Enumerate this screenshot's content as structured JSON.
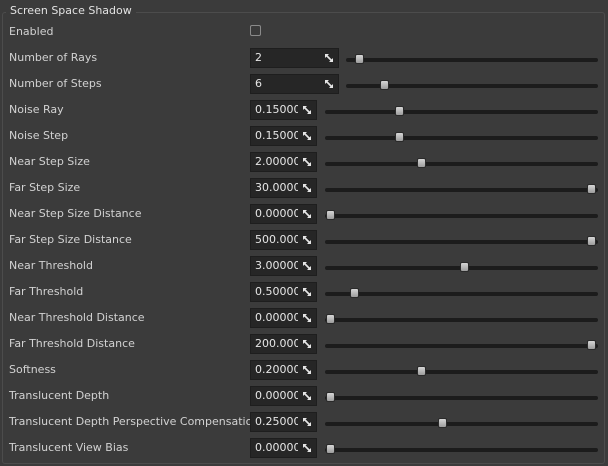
{
  "group": {
    "title": "Screen Space Shadow"
  },
  "enabled": {
    "label": "Enabled",
    "checked": false
  },
  "rows": [
    {
      "id": "number-of-rays",
      "label": "Number of Rays",
      "value": "2",
      "kind": "int",
      "slider_position": 0.05
    },
    {
      "id": "number-of-steps",
      "label": "Number of Steps",
      "value": "6",
      "kind": "int",
      "slider_position": 0.15
    },
    {
      "id": "noise-ray",
      "label": "Noise Ray",
      "value": "0.15000",
      "kind": "float",
      "slider_position": 0.27
    },
    {
      "id": "noise-step",
      "label": "Noise Step",
      "value": "0.15000",
      "kind": "float",
      "slider_position": 0.27
    },
    {
      "id": "near-step-size",
      "label": "Near Step Size",
      "value": "2.00000",
      "kind": "float",
      "slider_position": 0.35
    },
    {
      "id": "far-step-size",
      "label": "Far Step Size",
      "value": "30.00000",
      "kind": "float",
      "slider_position": 0.975
    },
    {
      "id": "near-step-size-distance",
      "label": "Near Step Size Distance",
      "value": "0.00000",
      "kind": "float",
      "slider_position": 0.02
    },
    {
      "id": "far-step-size-distance",
      "label": "Far Step Size Distance",
      "value": "500.0000",
      "kind": "float",
      "slider_position": 0.975
    },
    {
      "id": "near-threshold",
      "label": "Near Threshold",
      "value": "3.00000",
      "kind": "float",
      "slider_position": 0.51
    },
    {
      "id": "far-threshold",
      "label": "Far Threshold",
      "value": "0.50000",
      "kind": "float",
      "slider_position": 0.105
    },
    {
      "id": "near-threshold-distance",
      "label": "Near Threshold Distance",
      "value": "0.00000",
      "kind": "float",
      "slider_position": 0.02
    },
    {
      "id": "far-threshold-distance",
      "label": "Far Threshold Distance",
      "value": "200.0000",
      "kind": "float",
      "slider_position": 0.975
    },
    {
      "id": "softness",
      "label": "Softness",
      "value": "0.20000",
      "kind": "float",
      "slider_position": 0.35
    },
    {
      "id": "translucent-depth",
      "label": "Translucent Depth",
      "value": "0.00000",
      "kind": "float",
      "slider_position": 0.02
    },
    {
      "id": "translucent-depth-perspective-compensation",
      "label": "Translucent Depth Perspective Compensation",
      "value": "0.25000",
      "kind": "float",
      "slider_position": 0.43
    },
    {
      "id": "translucent-view-bias",
      "label": "Translucent View Bias",
      "value": "0.00000",
      "kind": "float",
      "slider_position": 0.02
    }
  ],
  "icons": {
    "field_expand": "expand-arrows-icon"
  }
}
